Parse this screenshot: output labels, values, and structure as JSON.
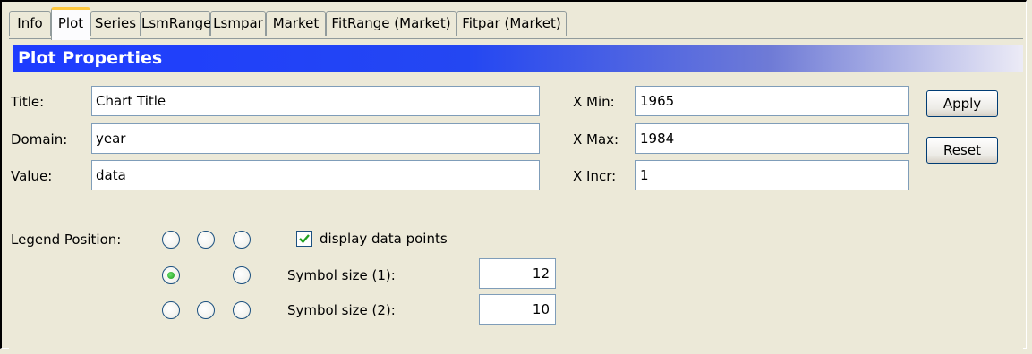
{
  "tabs": [
    {
      "label": "Info",
      "active": false
    },
    {
      "label": "Plot",
      "active": true
    },
    {
      "label": "Series",
      "active": false
    },
    {
      "label": "LsmRange",
      "active": false
    },
    {
      "label": "Lsmpar",
      "active": false
    },
    {
      "label": "Market",
      "active": false
    },
    {
      "label": "FitRange (Market)",
      "active": false
    },
    {
      "label": "Fitpar (Market)",
      "active": false
    }
  ],
  "section": {
    "title": "Plot Properties"
  },
  "form": {
    "title_label": "Title:",
    "title_value": "Chart Title",
    "domain_label": "Domain:",
    "domain_value": "year",
    "value_label": "Value:",
    "value_value": "data",
    "xmin_label": "X Min:",
    "xmin_value": "1965",
    "xmax_label": "X Max:",
    "xmax_value": "1984",
    "xincr_label": "X Incr:",
    "xincr_value": "1"
  },
  "buttons": {
    "apply": "Apply",
    "reset": "Reset"
  },
  "legend": {
    "label": "Legend Position:",
    "selected": "middle-left"
  },
  "display_points": {
    "label": "display data points",
    "checked": true
  },
  "symbols": {
    "size1_label": "Symbol size (1):",
    "size1_value": "12",
    "size2_label": "Symbol size (2):",
    "size2_value": "10"
  },
  "colors": {
    "header_start": "#1e3cff",
    "active_tab_accent": "#ffc83c",
    "background": "#ece9d8"
  }
}
